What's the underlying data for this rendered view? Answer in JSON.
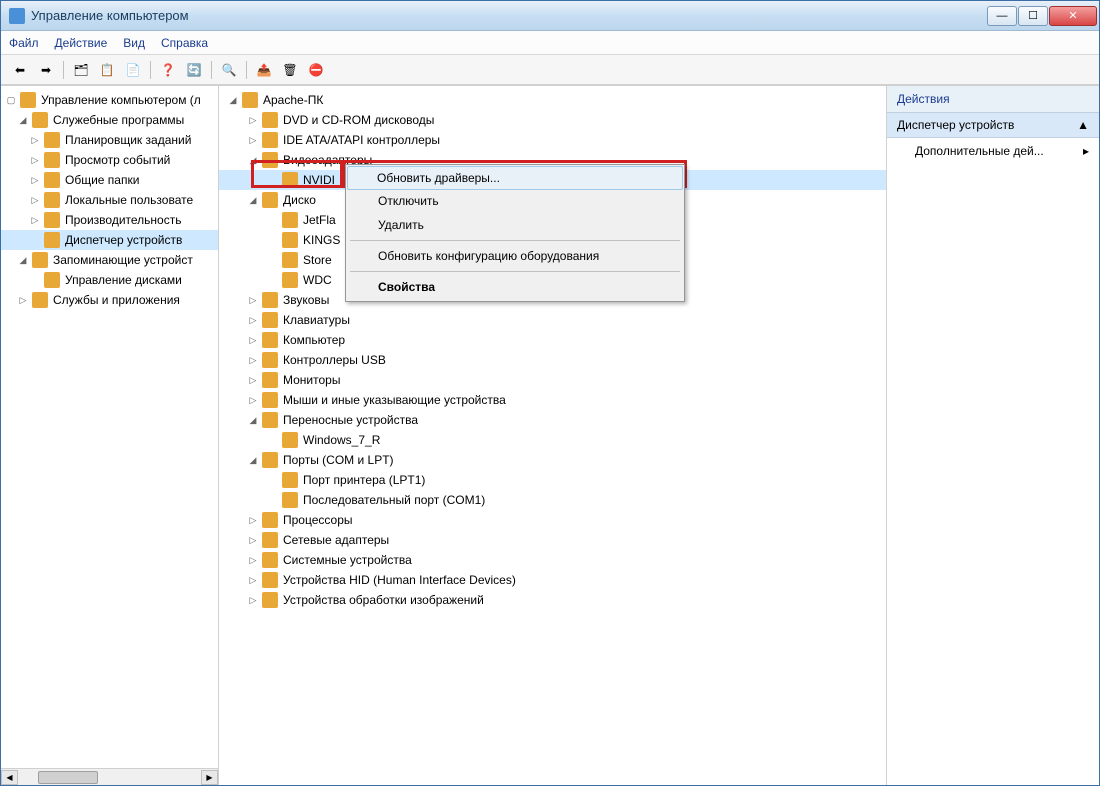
{
  "window": {
    "title": "Управление компьютером"
  },
  "menu": {
    "file": "Файл",
    "action": "Действие",
    "view": "Вид",
    "help": "Справка"
  },
  "left_tree": {
    "root": "Управление компьютером (л",
    "util": "Служебные программы",
    "scheduler": "Планировщик заданий",
    "events": "Просмотр событий",
    "folders": "Общие папки",
    "users": "Локальные пользовате",
    "perf": "Производительность",
    "devmgr": "Диспетчер устройств",
    "storage": "Запоминающие устройст",
    "diskmgmt": "Управление дисками",
    "services": "Службы и приложения"
  },
  "device_tree": {
    "root": "Apache-ПК",
    "dvd": "DVD и CD-ROM дисководы",
    "ide": "IDE ATA/ATAPI контроллеры",
    "video": "Видеоадаптеры",
    "nvidia": "NVIDI",
    "disks": "Диско",
    "jetflash": "JetFla",
    "kingston": "KINGS",
    "store": "Store",
    "wdc": "WDC",
    "sound": "Звуковы",
    "keyboards": "Клавиатуры",
    "computer": "Компьютер",
    "usb": "Контроллеры USB",
    "monitors": "Мониторы",
    "mice": "Мыши и иные указывающие устройства",
    "portable": "Переносные устройства",
    "win7r": "Windows_7_R",
    "ports": "Порты (COM и LPT)",
    "lpt1": "Порт принтера (LPT1)",
    "com1": "Последовательный порт (COM1)",
    "cpu": "Процессоры",
    "netadapters": "Сетевые адаптеры",
    "sysdevices": "Системные устройства",
    "hid": "Устройства HID (Human Interface Devices)",
    "imaging": "Устройства обработки изображений"
  },
  "context_menu": {
    "update_drivers": "Обновить драйверы...",
    "disable": "Отключить",
    "delete": "Удалить",
    "scan_hardware": "Обновить конфигурацию оборудования",
    "properties": "Свойства"
  },
  "actions_panel": {
    "header": "Действия",
    "section": "Диспетчер устройств",
    "more_actions": "Дополнительные дей..."
  }
}
